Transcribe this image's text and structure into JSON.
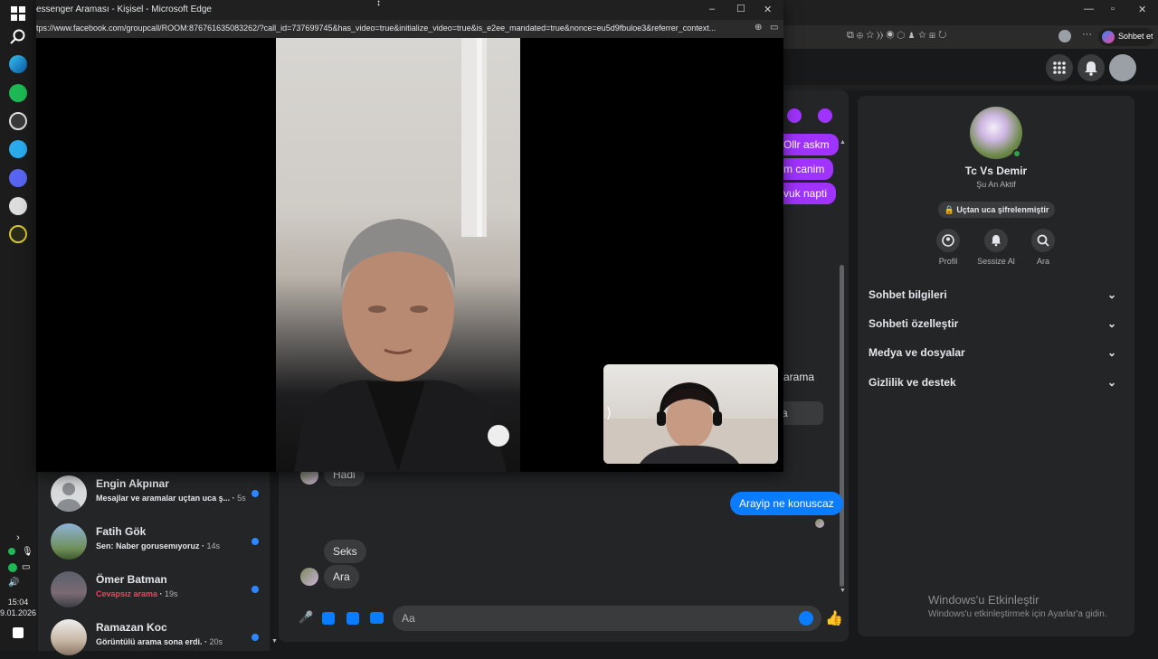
{
  "taskbar": {
    "time": "15:04",
    "date": "9.01.2026"
  },
  "popup": {
    "title": "essenger Araması - Kişisel - Microsoft Edge",
    "url": "tps://www.facebook.com/groupcall/ROOM:876761635083262/?call_id=737699745&has_video=true&initialize_video=true&is_e2ee_mandated=true&nonce=eu5d9fbuloe3&referrer_context...",
    "minimize": "–",
    "maximize": "☐",
    "close": "✕"
  },
  "edge_bg": {
    "copilot_label": "Sohbet et"
  },
  "chat": {
    "outgoing_top": [
      "Ollr askm",
      "m canim",
      "vuk napti"
    ],
    "partial_arama": "arama",
    "partial_a": "a",
    "incoming_hadi": "Hadi",
    "outgoing_main": "Arayip ne konuscaz",
    "incoming_seks": "Seks",
    "incoming_ara": "Ara",
    "composer_placeholder": "Aa"
  },
  "info": {
    "name": "Tc Vs Demir",
    "status": "Şu An Aktif",
    "encryption": "Uçtan uca şifrelenmiştir",
    "actions": [
      {
        "label": "Profil",
        "icon": "profile-icon"
      },
      {
        "label": "Sessize Al",
        "icon": "bell-icon"
      },
      {
        "label": "Ara",
        "icon": "search-icon"
      }
    ],
    "sections": [
      "Sohbet bilgileri",
      "Sohbeti özelleştir",
      "Medya ve dosyalar",
      "Gizlilik ve destek"
    ]
  },
  "watermark": {
    "title": "Windows'u Etkinleştir",
    "subtitle": "Windows'u etkinleştirmek için Ayarlar'a gidin."
  },
  "chat_list": [
    {
      "name": "Engin Akpınar",
      "preview": "Mesajlar ve aramalar uçtan uca ş...",
      "time": "5s",
      "preview_color": "#e4e6eb"
    },
    {
      "name": "Fatih Gök",
      "preview": "Sen: Naber gorusemıyoruz",
      "time": "14s",
      "preview_color": "#e4e6eb"
    },
    {
      "name": "Ömer Batman",
      "preview": "Cevapsız arama",
      "time": "19s",
      "preview_color": "#f3425f"
    },
    {
      "name": "Ramazan Koc",
      "preview": "Görüntülü arama sona erdi.",
      "time": "20s",
      "preview_color": "#e4e6eb"
    }
  ],
  "colors": {
    "accent_purple": "#a033ff",
    "messenger_blue": "#0a7cff",
    "unread_dot": "#2d88ff"
  }
}
